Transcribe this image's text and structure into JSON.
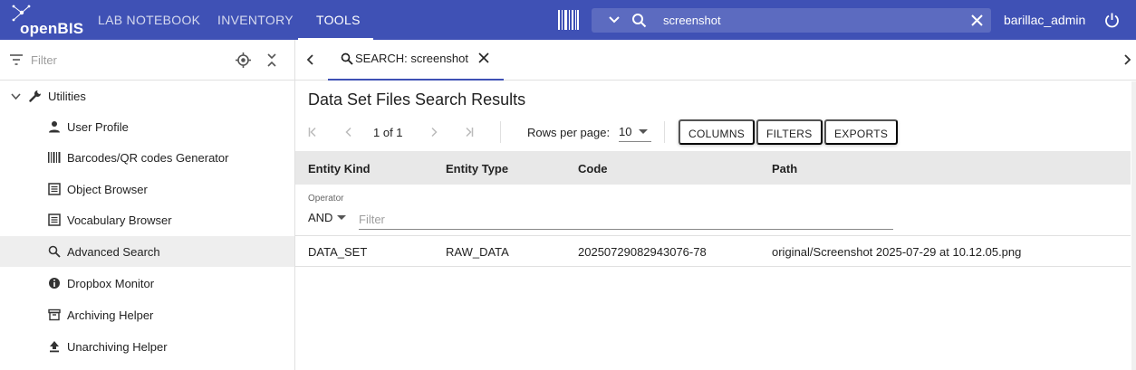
{
  "app": {
    "logo_text": "openBIS"
  },
  "nav": {
    "tabs": [
      {
        "label": "LAB NOTEBOOK"
      },
      {
        "label": "INVENTORY"
      },
      {
        "label": "TOOLS"
      }
    ]
  },
  "search": {
    "value": "screenshot",
    "placeholder": ""
  },
  "user": {
    "name": "barillac_admin"
  },
  "sidebar": {
    "filter_placeholder": "Filter",
    "root": {
      "label": "Utilities"
    },
    "items": [
      {
        "label": "User Profile",
        "icon": "user-icon"
      },
      {
        "label": "Barcodes/QR codes Generator",
        "icon": "barcode-icon"
      },
      {
        "label": "Object Browser",
        "icon": "list-icon"
      },
      {
        "label": "Vocabulary Browser",
        "icon": "list-icon"
      },
      {
        "label": "Advanced Search",
        "icon": "search-icon"
      },
      {
        "label": "Dropbox Monitor",
        "icon": "info-icon"
      },
      {
        "label": "Archiving Helper",
        "icon": "archive-icon"
      },
      {
        "label": "Unarchiving Helper",
        "icon": "upload-icon"
      }
    ]
  },
  "content": {
    "tab": {
      "label": "SEARCH: screenshot"
    },
    "title": "Data Set Files Search Results",
    "pager": {
      "page_count": "1 of 1",
      "rows_per_page_label": "Rows per page:",
      "rows_per_page": "10"
    },
    "buttons": {
      "columns": "COLUMNS",
      "filters": "FILTERS",
      "exports": "EXPORTS"
    },
    "table": {
      "headers": [
        "Entity Kind",
        "Entity Type",
        "Code",
        "Path"
      ],
      "operator_label": "Operator",
      "operator_value": "AND",
      "filter_placeholder": "Filter",
      "rows": [
        [
          "DATA_SET",
          "RAW_DATA",
          "20250729082943076-78",
          "original/Screenshot 2025-07-29 at 10.12.05.png"
        ]
      ]
    }
  },
  "colors": {
    "primary": "#3f51b5",
    "search_bg": "#5c6bc0",
    "selected_bg": "#eeeeee",
    "header_bg": "#e8e8e8"
  }
}
